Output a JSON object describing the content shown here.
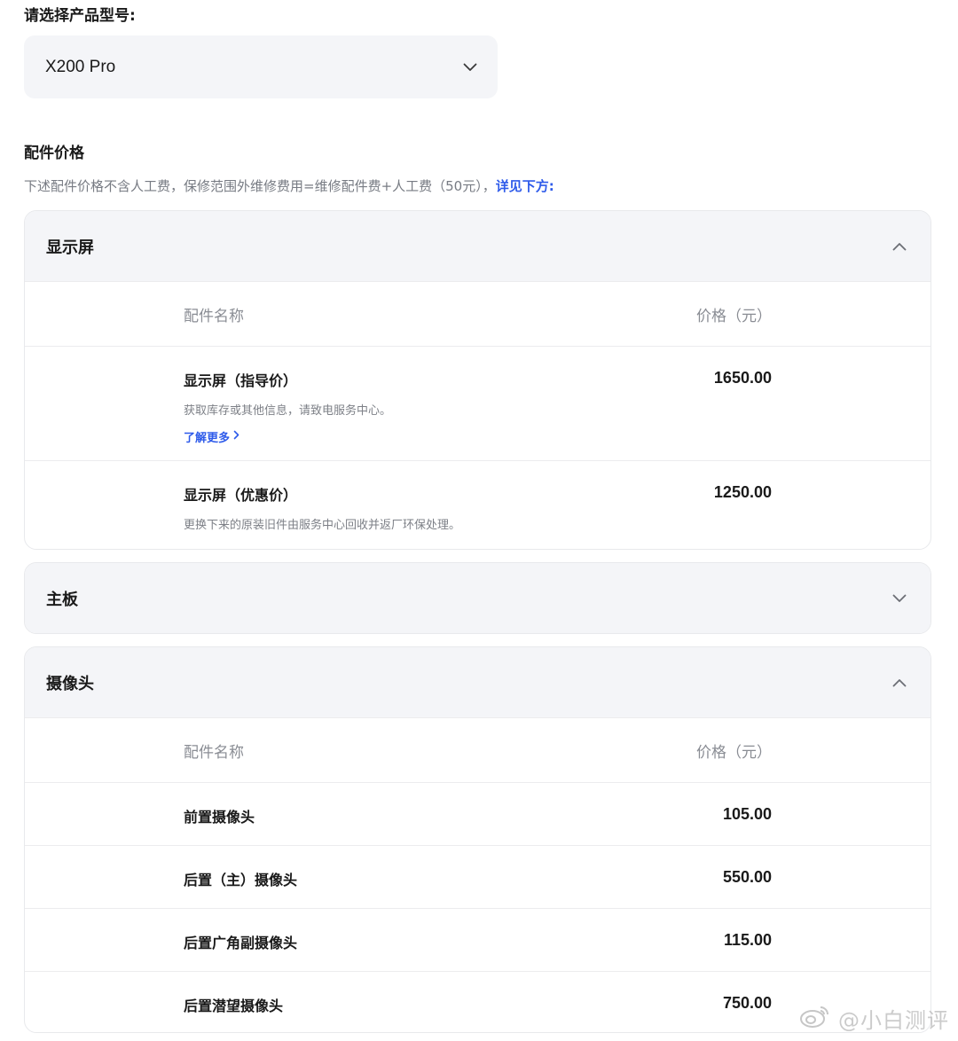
{
  "selector": {
    "label": "请选择产品型号:",
    "value": "X200 Pro"
  },
  "section": {
    "title": "配件价格",
    "desc": "下述配件价格不含人工费，保修范围外维修费用=维修配件费+人工费（50元），",
    "desc_link": "详见下方:"
  },
  "panels": [
    {
      "title": "显示屏",
      "expanded": true,
      "header": {
        "name": "配件名称",
        "price": "价格（元）"
      },
      "rows": [
        {
          "name": "显示屏（指导价）",
          "note": "获取库存或其他信息，请致电服务中心。",
          "link": "了解更多",
          "price": "1650.00"
        },
        {
          "name": "显示屏（优惠价）",
          "note": "更换下来的原装旧件由服务中心回收并返厂环保处理。",
          "price": "1250.00"
        }
      ]
    },
    {
      "title": "主板",
      "expanded": false
    },
    {
      "title": "摄像头",
      "expanded": true,
      "header": {
        "name": "配件名称",
        "price": "价格（元）"
      },
      "rows": [
        {
          "name": "前置摄像头",
          "price": "105.00"
        },
        {
          "name": "后置（主）摄像头",
          "price": "550.00"
        },
        {
          "name": "后置广角副摄像头",
          "price": "115.00"
        },
        {
          "name": "后置潜望摄像头",
          "price": "750.00"
        }
      ]
    }
  ],
  "watermark": "@小白测评",
  "icons": {
    "dropdown": "chevron-down-icon",
    "collapse": "chevron-up-icon",
    "expand": "chevron-down-icon",
    "link": "chevron-right-icon",
    "watermark": "weibo-icon"
  },
  "colors": {
    "link": "#2e5bea",
    "panel_header_bg": "#f4f5f8",
    "muted_text": "#777b83"
  }
}
